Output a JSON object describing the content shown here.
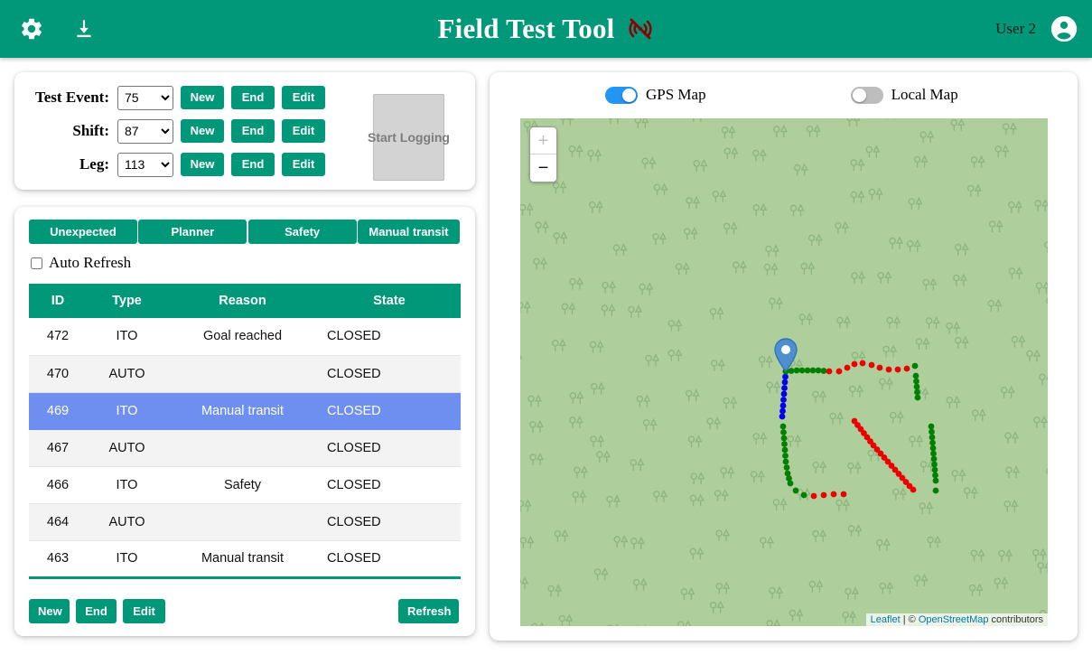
{
  "header": {
    "title": "Field Test Tool",
    "settings_icon": "gear-icon",
    "download_icon": "download-icon",
    "connection_icon": "signal-off-icon",
    "user_name": "User 2",
    "avatar_icon": "account-circle-icon",
    "brand_color": "#009879"
  },
  "selector": {
    "rows": [
      {
        "label": "Test Event:",
        "value": "75",
        "new_label": "New",
        "end_label": "End",
        "edit_label": "Edit"
      },
      {
        "label": "Shift:",
        "value": "87",
        "new_label": "New",
        "end_label": "End",
        "edit_label": "Edit"
      },
      {
        "label": "Leg:",
        "value": "113",
        "new_label": "New",
        "end_label": "End",
        "edit_label": "Edit"
      }
    ],
    "start_logging_label": "Start Logging",
    "start_logging_enabled": false
  },
  "events": {
    "filters": [
      {
        "label": "Unexpected"
      },
      {
        "label": "Planner"
      },
      {
        "label": "Safety"
      },
      {
        "label": "Manual transit"
      }
    ],
    "auto_refresh_label": "Auto Refresh",
    "auto_refresh_checked": false,
    "columns": [
      "ID",
      "Type",
      "Reason",
      "State"
    ],
    "rows": [
      {
        "id": "472",
        "type": "ITO",
        "reason": "Goal reached",
        "state": "CLOSED",
        "selected": false
      },
      {
        "id": "470",
        "type": "AUTO",
        "reason": "",
        "state": "CLOSED",
        "selected": false
      },
      {
        "id": "469",
        "type": "ITO",
        "reason": "Manual transit",
        "state": "CLOSED",
        "selected": true
      },
      {
        "id": "467",
        "type": "AUTO",
        "reason": "",
        "state": "CLOSED",
        "selected": false
      },
      {
        "id": "466",
        "type": "ITO",
        "reason": "Safety",
        "state": "CLOSED",
        "selected": false
      },
      {
        "id": "464",
        "type": "AUTO",
        "reason": "",
        "state": "CLOSED",
        "selected": false
      },
      {
        "id": "463",
        "type": "ITO",
        "reason": "Manual transit",
        "state": "CLOSED",
        "selected": false
      }
    ],
    "actions": {
      "new_label": "New",
      "end_label": "End",
      "edit_label": "Edit",
      "refresh_label": "Refresh"
    },
    "selected_row_color": "#6f8ff0"
  },
  "map": {
    "gps_map_label": "GPS Map",
    "gps_map_on": true,
    "local_map_label": "Local Map",
    "local_map_on": false,
    "zoom_in_label": "+",
    "zoom_out_label": "−",
    "zoom_in_enabled": false,
    "attribution": {
      "leaflet": "Leaflet",
      "separator": " | © ",
      "osm": "OpenStreetMap",
      "suffix": " contributors"
    },
    "marker_icon": "map-pin-icon",
    "track_colors": {
      "green": "#008000",
      "blue": "#0000ee",
      "red": "#ee0000"
    }
  }
}
